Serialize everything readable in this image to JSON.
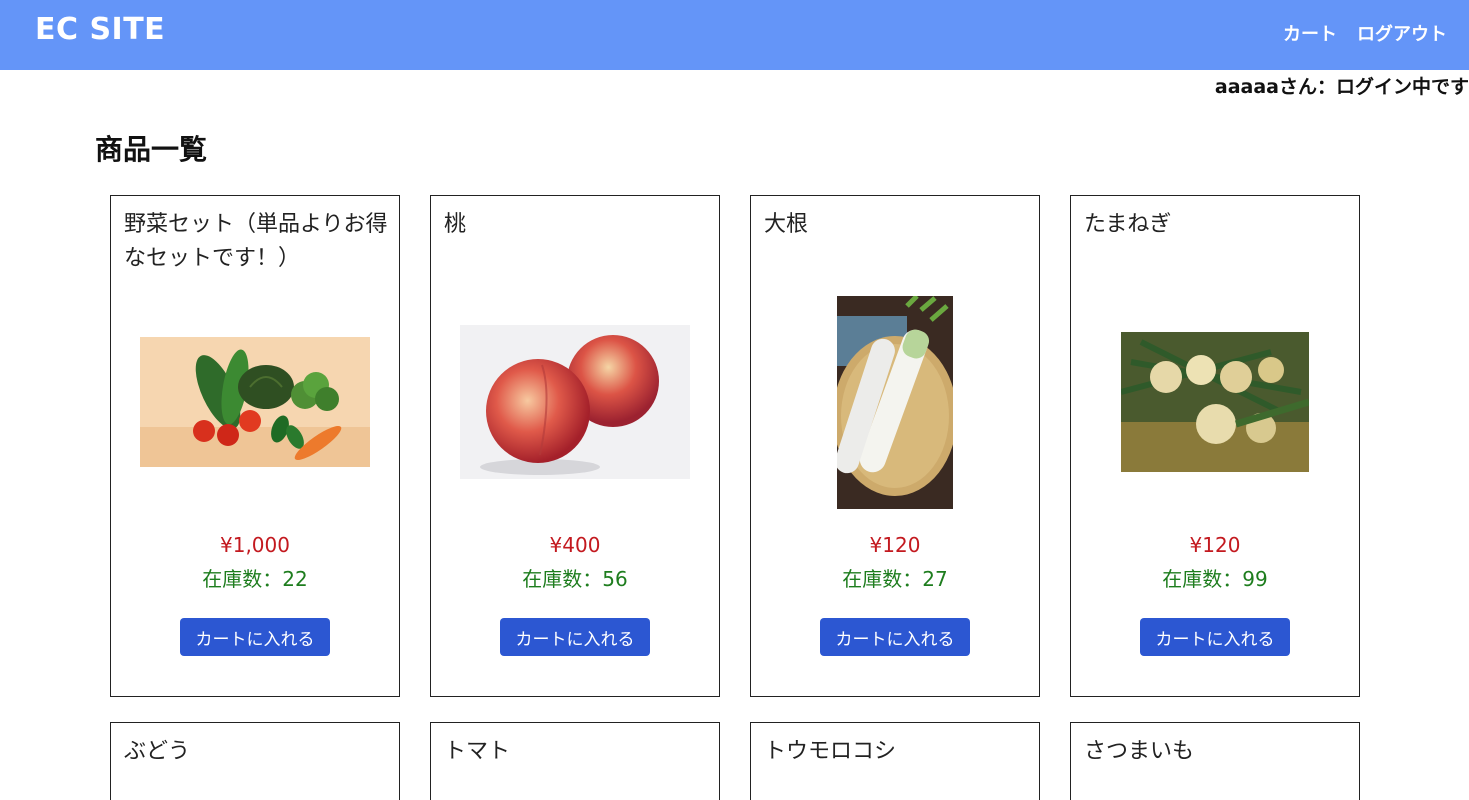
{
  "header": {
    "logo": "EC SITE",
    "nav": {
      "cart": "カート",
      "logout": "ログアウト"
    },
    "background_color": "#6495f8"
  },
  "login_status": "aaaaaさん：ログイン中です",
  "page_title": "商品一覧",
  "products": [
    {
      "name": "野菜セット（単品よりお得なセットです！）",
      "price": "¥1,000",
      "stock": "在庫数：22",
      "button": "カートに入れる",
      "image": "vegetable-set-photo"
    },
    {
      "name": "桃",
      "price": "¥400",
      "stock": "在庫数：56",
      "button": "カートに入れる",
      "image": "peach-photo"
    },
    {
      "name": "大根",
      "price": "¥120",
      "stock": "在庫数：27",
      "button": "カートに入れる",
      "image": "daikon-photo"
    },
    {
      "name": "たまねぎ",
      "price": "¥120",
      "stock": "在庫数：99",
      "button": "カートに入れる",
      "image": "onion-photo"
    },
    {
      "name": "ぶどう"
    },
    {
      "name": "トマト"
    },
    {
      "name": "トウモロコシ"
    },
    {
      "name": "さつまいも"
    }
  ],
  "colors": {
    "price": "#c3191f",
    "stock": "#1e7d1e",
    "button": "#2c57d2"
  }
}
